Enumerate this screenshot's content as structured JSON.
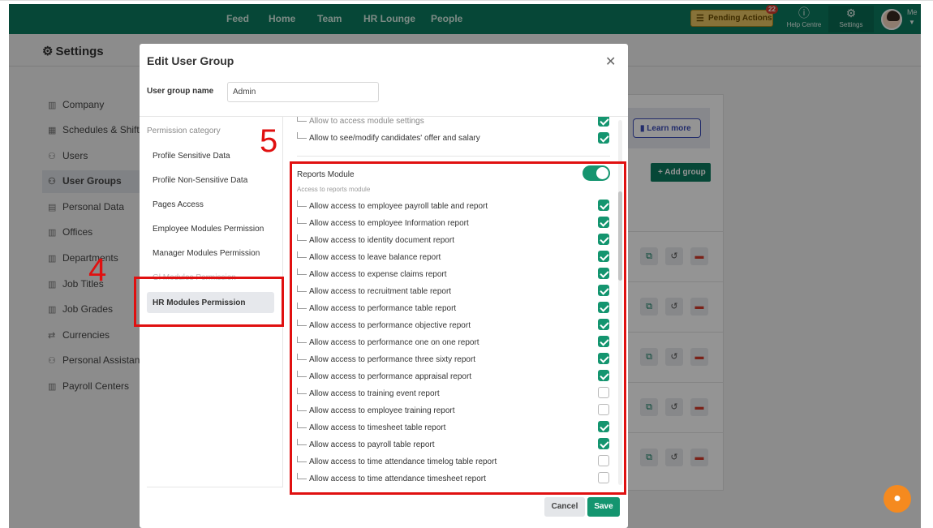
{
  "topbar": {
    "nav": [
      "Feed",
      "Home",
      "Team",
      "HR Lounge",
      "People"
    ],
    "pending_actions": "Pending Actions",
    "pending_count": "22",
    "help_centre": "Help Centre",
    "settings": "Settings",
    "me": "Me"
  },
  "page": {
    "title": "Settings"
  },
  "sidebar": {
    "items": [
      {
        "label": "Company",
        "icon": "building-icon"
      },
      {
        "label": "Schedules & Shifts",
        "icon": "calendar-icon"
      },
      {
        "label": "Users",
        "icon": "users-icon"
      },
      {
        "label": "User Groups",
        "icon": "user-group-icon"
      },
      {
        "label": "Personal Data",
        "icon": "id-card-icon"
      },
      {
        "label": "Offices",
        "icon": "building-icon"
      },
      {
        "label": "Departments",
        "icon": "building-icon"
      },
      {
        "label": "Job Titles",
        "icon": "building-icon"
      },
      {
        "label": "Job Grades",
        "icon": "building-icon"
      },
      {
        "label": "Currencies",
        "icon": "exchange-icon"
      },
      {
        "label": "Personal Assistant",
        "icon": "users-icon"
      },
      {
        "label": "Payroll Centers",
        "icon": "building-icon"
      }
    ],
    "active_index": 3
  },
  "content": {
    "learn_more": "Learn more",
    "add_group": "+ Add group"
  },
  "modal": {
    "title": "Edit User Group",
    "group_name_label": "User group name",
    "group_name_value": "Admin",
    "category_heading": "Permission category",
    "categories": [
      "Profile Sensitive Data",
      "Profile Non-Sensitive Data",
      "Pages Access",
      "Employee Modules Permission",
      "Manager Modules Permission",
      "Gl Modules Permission",
      "HR Modules Permission"
    ],
    "active_category": "HR Modules Permission",
    "prev_rows": [
      {
        "label": "Allow to access module settings",
        "checked": true
      },
      {
        "label": "Allow to see/modify candidates' offer and salary",
        "checked": true
      }
    ],
    "module": {
      "title": "Reports Module",
      "subtitle": "Access to reports module",
      "enabled": true
    },
    "permissions": [
      {
        "label": "Allow access to employee payroll table and report",
        "checked": true
      },
      {
        "label": "Allow access to employee Information report",
        "checked": true
      },
      {
        "label": "Allow access to identity document report",
        "checked": true
      },
      {
        "label": "Allow access to leave balance report",
        "checked": true
      },
      {
        "label": "Allow access to expense claims report",
        "checked": true
      },
      {
        "label": "Allow access to recruitment table report",
        "checked": true
      },
      {
        "label": "Allow access to performance table report",
        "checked": true
      },
      {
        "label": "Allow access to performance objective report",
        "checked": true
      },
      {
        "label": "Allow access to performance one on one report",
        "checked": true
      },
      {
        "label": "Allow access to performance three sixty report",
        "checked": true
      },
      {
        "label": "Allow access to performance appraisal report",
        "checked": true
      },
      {
        "label": "Allow access to training event report",
        "checked": false
      },
      {
        "label": "Allow access to employee training report",
        "checked": false
      },
      {
        "label": "Allow access to timesheet table report",
        "checked": true
      },
      {
        "label": "Allow access to payroll table report",
        "checked": true
      },
      {
        "label": "Allow access to time attendance timelog table report",
        "checked": false
      },
      {
        "label": "Allow access to time attendance timesheet report",
        "checked": false
      }
    ],
    "cancel": "Cancel",
    "save": "Save"
  },
  "annotations": {
    "step4": "4",
    "step5": "5",
    "color": "#e01010"
  },
  "colors": {
    "brand": "#0c7a5f",
    "check": "#14956f",
    "pending": "#e9c462",
    "fab": "#f58a1f"
  }
}
